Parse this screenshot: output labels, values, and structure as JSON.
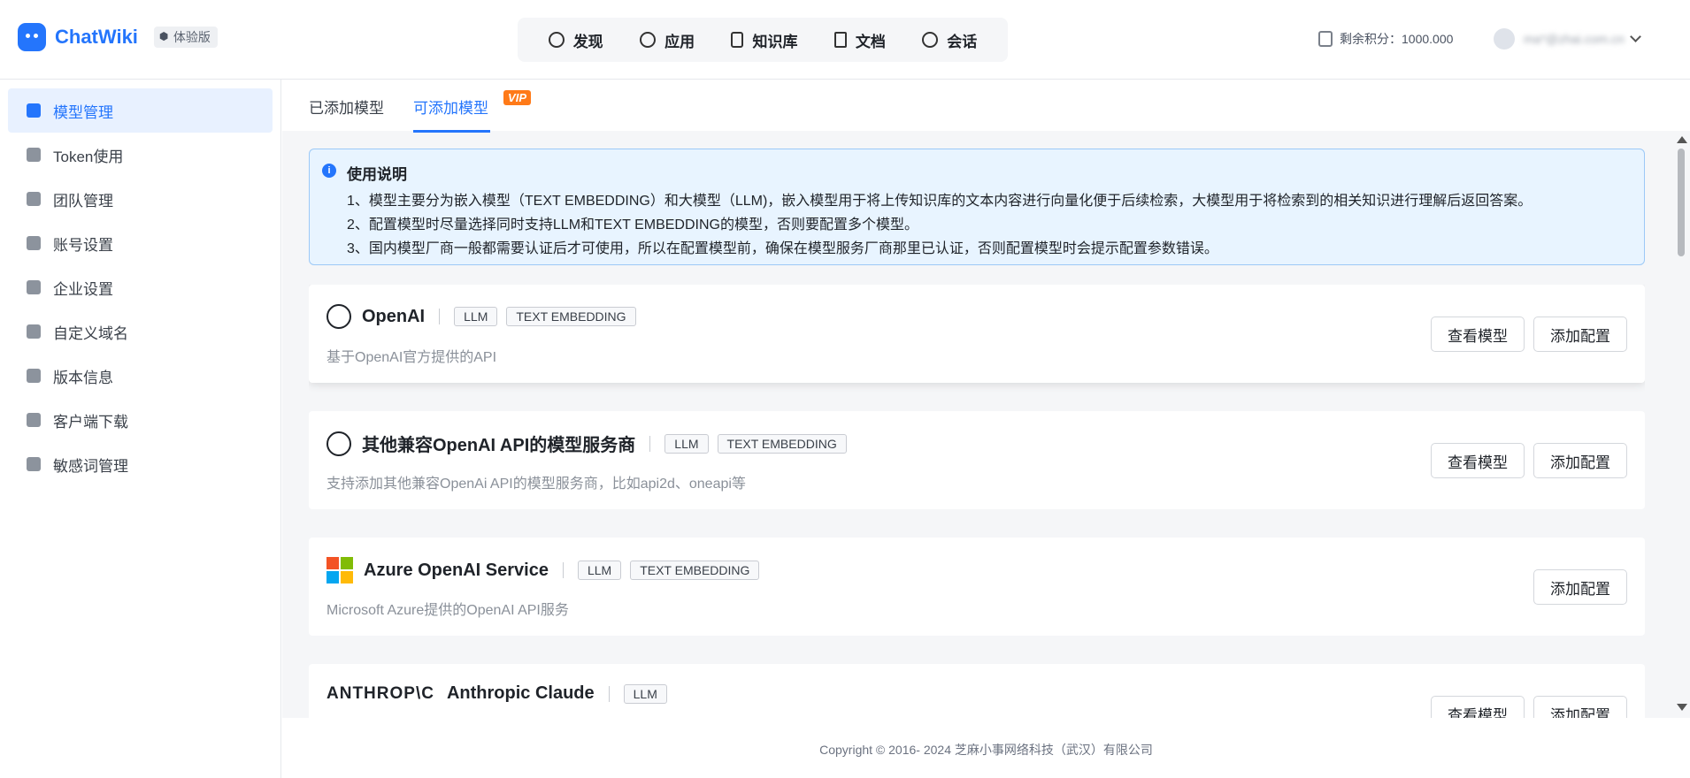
{
  "app": {
    "name": "ChatWiki",
    "edition_badge": "体验版"
  },
  "topnav": [
    {
      "label": "发现",
      "icon": "discover-icon"
    },
    {
      "label": "应用",
      "icon": "robot-icon"
    },
    {
      "label": "知识库",
      "icon": "book-icon"
    },
    {
      "label": "文档",
      "icon": "document-icon"
    },
    {
      "label": "会话",
      "icon": "chat-icon"
    }
  ],
  "header": {
    "points_label": "剩余积分：1000.000",
    "user_email": "ma*@zhai.com.cn"
  },
  "sidebar": {
    "items": [
      {
        "label": "模型管理"
      },
      {
        "label": "Token使用"
      },
      {
        "label": "团队管理"
      },
      {
        "label": "账号设置"
      },
      {
        "label": "企业设置"
      },
      {
        "label": "自定义域名"
      },
      {
        "label": "版本信息"
      },
      {
        "label": "客户端下载"
      },
      {
        "label": "敏感词管理"
      }
    ]
  },
  "tabs": {
    "added": "已添加模型",
    "addable": "可添加模型",
    "vip": "VIP"
  },
  "notice": {
    "title": "使用说明",
    "lines": [
      "1、模型主要分为嵌入模型（TEXT EMBEDDING）和大模型（LLM)，嵌入模型用于将上传知识库的文本内容进行向量化便于后续检索，大模型用于将检索到的相关知识进行理解后返回答案。",
      "2、配置模型时尽量选择同时支持LLM和TEXT EMBEDDING的模型，否则要配置多个模型。",
      "3、国内模型厂商一般都需要认证后才可使用，所以在配置模型前，确保在模型服务厂商那里已认证，否则配置模型时会提示配置参数错误。"
    ]
  },
  "cards": [
    {
      "name": "OpenAI",
      "tags": [
        "LLM",
        "TEXT EMBEDDING"
      ],
      "desc": "基于OpenAI官方提供的API",
      "view": "查看模型",
      "add": "添加配置"
    },
    {
      "name": "其他兼容OpenAI API的模型服务商",
      "tags": [
        "LLM",
        "TEXT EMBEDDING"
      ],
      "desc": "支持添加其他兼容OpenAi API的模型服务商，比如api2d、oneapi等",
      "view": "查看模型",
      "add": "添加配置"
    },
    {
      "name": "Azure OpenAI Service",
      "tags": [
        "LLM",
        "TEXT EMBEDDING"
      ],
      "desc": "Microsoft Azure提供的OpenAI API服务",
      "add": "添加配置"
    },
    {
      "logo_text": "ANTHROP\\C",
      "name": "Anthropic Claude",
      "tags": [
        "LLM"
      ],
      "view": "查看模型",
      "add": "添加配置"
    }
  ],
  "footer": {
    "copyright": "Copyright © 2016- 2024 芝麻小事网络科技（武汉）有限公司"
  },
  "colors": {
    "accent": "#2475fc",
    "vip": "#ff7a18"
  }
}
